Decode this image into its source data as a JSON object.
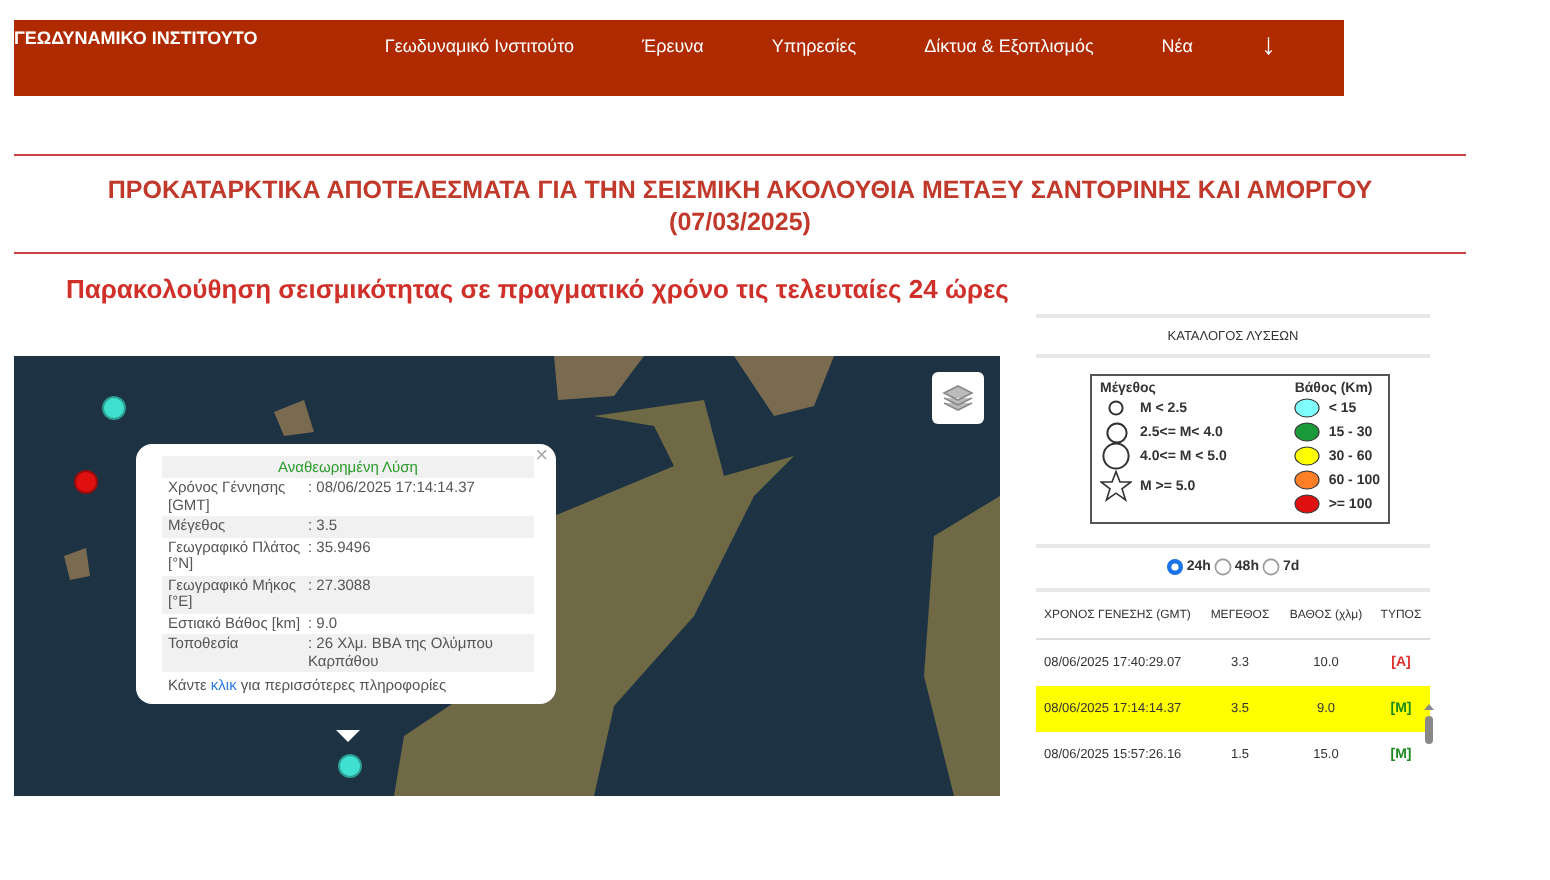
{
  "header": {
    "logo": "ΓΕΩΔΥΝΑΜΙΚΟ ΙΝΣΤΙΤΟΥΤΟ",
    "nav": [
      "Γεωδυναμικό Ινστιτούτο",
      "Έρευνα",
      "Υπηρεσίες",
      "Δίκτυα & Εξοπλισμός",
      "Νέα"
    ],
    "nav_arrow": "↓"
  },
  "title_line_1": "ΠΡΟΚΑΤΑΡΚΤΙΚΑ ΑΠΟΤΕΛΕΣΜΑΤΑ ΓΙΑ ΤΗΝ ΣΕΙΣΜΙΚΗ ΑΚΟΛΟΥΘΙΑ ΜΕΤΑΞΥ ΣΑΝΤΟΡΙΝΗΣ ΚΑΙ ΑΜΟΡΓΟΥ",
  "title_line_2": "(07/03/2025)",
  "subtitle": "Παρακολούθηση σεισμικότητας σε πραγματικό χρόνο τις τελευταίες 24 ώρες",
  "map": {
    "markers": [
      {
        "color": "#40e0d0"
      },
      {
        "color": "#e01010"
      },
      {
        "color": "#40e0d0"
      }
    ],
    "popup": {
      "heading": "Αναθεωρημένη Λύση",
      "close": "×",
      "rows": [
        {
          "label": "Χρόνος Γέννησης [GMT]",
          "value": ": 08/06/2025 17:14:14.37"
        },
        {
          "label": "Μέγεθος",
          "value": ": 3.5"
        },
        {
          "label": "Γεωγραφικό Πλάτος [°N]",
          "value": ": 35.9496"
        },
        {
          "label": "Γεωγραφικό Μήκος [°E]",
          "value": ": 27.3088"
        },
        {
          "label": "Εστιακό Βάθος [km]",
          "value": ": 9.0"
        },
        {
          "label": "Τοποθεσία",
          "value": ": 26 Χλμ. ΒΒΑ της Ολύμπου Καρπάθου"
        }
      ],
      "footer_before": "Κάντε",
      "footer_link": "κλικ",
      "footer_after": "για περισσότερες πληροφορίες"
    }
  },
  "catalog": {
    "title": "ΚΑΤΑΛΟΓΟΣ ΛΥΣΕΩΝ",
    "legend": {
      "magnitude_title": "Μέγεθος",
      "depth_title": "Βάθος (Km)",
      "magnitudes": [
        {
          "kind": "small",
          "label": "M < 2.5"
        },
        {
          "kind": "medium",
          "label": "2.5<= M< 4.0"
        },
        {
          "kind": "large",
          "label": "4.0<= M < 5.0"
        },
        {
          "kind": "star",
          "label": "M >= 5.0"
        }
      ],
      "depths": [
        {
          "color": "#80ffff",
          "label": "< 15"
        },
        {
          "color": "#1a9a3a",
          "label": "15 - 30"
        },
        {
          "color": "#ffff00",
          "label": "30 - 60"
        },
        {
          "color": "#ff7f27",
          "label": "60 - 100"
        },
        {
          "color": "#e01010",
          "label": ">= 100"
        }
      ]
    },
    "periods": [
      {
        "label": "24h",
        "selected": true
      },
      {
        "label": "48h",
        "selected": false
      },
      {
        "label": "7d",
        "selected": false
      }
    ],
    "columns": [
      "ΧΡΟΝΟΣ ΓΕΝΕΣΗΣ (GMT)",
      "ΜΕΓΕΘΟΣ",
      "ΒΑΘΟΣ (χλμ)",
      "ΤΥΠΟΣ"
    ],
    "rows": [
      {
        "time": "08/06/2025 17:40:29.07",
        "magnitude": "3.3",
        "depth": "10.0",
        "type": "[A]",
        "color": "#e03030",
        "selected": false
      },
      {
        "time": "08/06/2025 17:14:14.37",
        "magnitude": "3.5",
        "depth": "9.0",
        "type": "[M]",
        "color": "#1a8a1a",
        "selected": true
      },
      {
        "time": "08/06/2025 15:57:26.16",
        "magnitude": "1.5",
        "depth": "15.0",
        "type": "[M]",
        "color": "#1a8a1a",
        "selected": false
      }
    ]
  }
}
